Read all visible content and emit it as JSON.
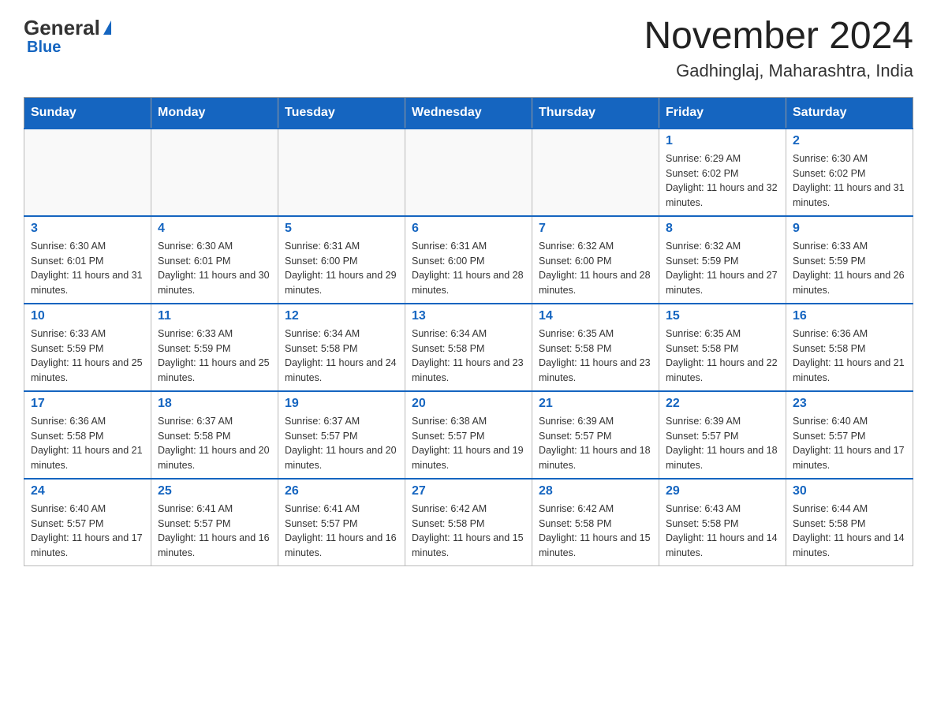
{
  "header": {
    "logo_general": "General",
    "logo_blue": "Blue",
    "month_title": "November 2024",
    "location": "Gadhinglaj, Maharashtra, India"
  },
  "days_of_week": [
    "Sunday",
    "Monday",
    "Tuesday",
    "Wednesday",
    "Thursday",
    "Friday",
    "Saturday"
  ],
  "weeks": [
    [
      {
        "day": "",
        "info": ""
      },
      {
        "day": "",
        "info": ""
      },
      {
        "day": "",
        "info": ""
      },
      {
        "day": "",
        "info": ""
      },
      {
        "day": "",
        "info": ""
      },
      {
        "day": "1",
        "info": "Sunrise: 6:29 AM\nSunset: 6:02 PM\nDaylight: 11 hours and 32 minutes."
      },
      {
        "day": "2",
        "info": "Sunrise: 6:30 AM\nSunset: 6:02 PM\nDaylight: 11 hours and 31 minutes."
      }
    ],
    [
      {
        "day": "3",
        "info": "Sunrise: 6:30 AM\nSunset: 6:01 PM\nDaylight: 11 hours and 31 minutes."
      },
      {
        "day": "4",
        "info": "Sunrise: 6:30 AM\nSunset: 6:01 PM\nDaylight: 11 hours and 30 minutes."
      },
      {
        "day": "5",
        "info": "Sunrise: 6:31 AM\nSunset: 6:00 PM\nDaylight: 11 hours and 29 minutes."
      },
      {
        "day": "6",
        "info": "Sunrise: 6:31 AM\nSunset: 6:00 PM\nDaylight: 11 hours and 28 minutes."
      },
      {
        "day": "7",
        "info": "Sunrise: 6:32 AM\nSunset: 6:00 PM\nDaylight: 11 hours and 28 minutes."
      },
      {
        "day": "8",
        "info": "Sunrise: 6:32 AM\nSunset: 5:59 PM\nDaylight: 11 hours and 27 minutes."
      },
      {
        "day": "9",
        "info": "Sunrise: 6:33 AM\nSunset: 5:59 PM\nDaylight: 11 hours and 26 minutes."
      }
    ],
    [
      {
        "day": "10",
        "info": "Sunrise: 6:33 AM\nSunset: 5:59 PM\nDaylight: 11 hours and 25 minutes."
      },
      {
        "day": "11",
        "info": "Sunrise: 6:33 AM\nSunset: 5:59 PM\nDaylight: 11 hours and 25 minutes."
      },
      {
        "day": "12",
        "info": "Sunrise: 6:34 AM\nSunset: 5:58 PM\nDaylight: 11 hours and 24 minutes."
      },
      {
        "day": "13",
        "info": "Sunrise: 6:34 AM\nSunset: 5:58 PM\nDaylight: 11 hours and 23 minutes."
      },
      {
        "day": "14",
        "info": "Sunrise: 6:35 AM\nSunset: 5:58 PM\nDaylight: 11 hours and 23 minutes."
      },
      {
        "day": "15",
        "info": "Sunrise: 6:35 AM\nSunset: 5:58 PM\nDaylight: 11 hours and 22 minutes."
      },
      {
        "day": "16",
        "info": "Sunrise: 6:36 AM\nSunset: 5:58 PM\nDaylight: 11 hours and 21 minutes."
      }
    ],
    [
      {
        "day": "17",
        "info": "Sunrise: 6:36 AM\nSunset: 5:58 PM\nDaylight: 11 hours and 21 minutes."
      },
      {
        "day": "18",
        "info": "Sunrise: 6:37 AM\nSunset: 5:58 PM\nDaylight: 11 hours and 20 minutes."
      },
      {
        "day": "19",
        "info": "Sunrise: 6:37 AM\nSunset: 5:57 PM\nDaylight: 11 hours and 20 minutes."
      },
      {
        "day": "20",
        "info": "Sunrise: 6:38 AM\nSunset: 5:57 PM\nDaylight: 11 hours and 19 minutes."
      },
      {
        "day": "21",
        "info": "Sunrise: 6:39 AM\nSunset: 5:57 PM\nDaylight: 11 hours and 18 minutes."
      },
      {
        "day": "22",
        "info": "Sunrise: 6:39 AM\nSunset: 5:57 PM\nDaylight: 11 hours and 18 minutes."
      },
      {
        "day": "23",
        "info": "Sunrise: 6:40 AM\nSunset: 5:57 PM\nDaylight: 11 hours and 17 minutes."
      }
    ],
    [
      {
        "day": "24",
        "info": "Sunrise: 6:40 AM\nSunset: 5:57 PM\nDaylight: 11 hours and 17 minutes."
      },
      {
        "day": "25",
        "info": "Sunrise: 6:41 AM\nSunset: 5:57 PM\nDaylight: 11 hours and 16 minutes."
      },
      {
        "day": "26",
        "info": "Sunrise: 6:41 AM\nSunset: 5:57 PM\nDaylight: 11 hours and 16 minutes."
      },
      {
        "day": "27",
        "info": "Sunrise: 6:42 AM\nSunset: 5:58 PM\nDaylight: 11 hours and 15 minutes."
      },
      {
        "day": "28",
        "info": "Sunrise: 6:42 AM\nSunset: 5:58 PM\nDaylight: 11 hours and 15 minutes."
      },
      {
        "day": "29",
        "info": "Sunrise: 6:43 AM\nSunset: 5:58 PM\nDaylight: 11 hours and 14 minutes."
      },
      {
        "day": "30",
        "info": "Sunrise: 6:44 AM\nSunset: 5:58 PM\nDaylight: 11 hours and 14 minutes."
      }
    ]
  ]
}
